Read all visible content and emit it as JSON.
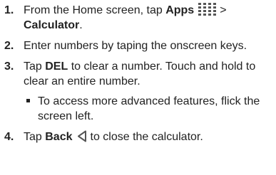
{
  "steps": [
    {
      "number": "1.",
      "text_before": "From the Home screen, tap ",
      "bold_1": "Apps",
      "separator": ">",
      "bold_2": "Calculator",
      "text_after": "."
    },
    {
      "number": "2.",
      "text": "Enter numbers by taping the onscreen keys."
    },
    {
      "number": "3.",
      "text_before": "Tap ",
      "bold": "DEL",
      "text_after": " to clear a number. Touch and hold to clear an entire number.",
      "bullet": "To access more advanced features, flick the screen left."
    },
    {
      "number": "4.",
      "text_before": "Tap ",
      "bold": "Back",
      "text_after": "to close the calculator."
    }
  ],
  "icons": {
    "apps": "apps-grid-icon",
    "back": "back-triangle-icon"
  },
  "colors": {
    "text": "#222222",
    "icon": "#555555"
  }
}
